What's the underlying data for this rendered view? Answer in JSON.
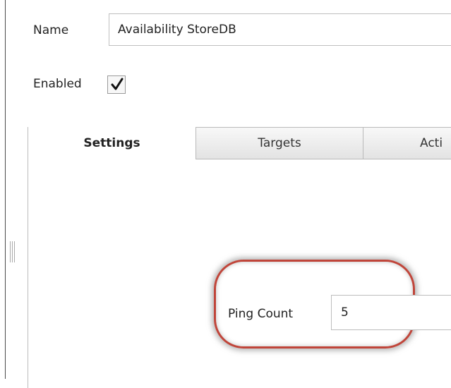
{
  "form": {
    "name_label": "Name",
    "name_value": "Availability StoreDB",
    "enabled_label": "Enabled",
    "enabled_checked": true
  },
  "tabs": [
    {
      "label": "Settings",
      "active": true
    },
    {
      "label": "Targets",
      "active": false
    },
    {
      "label": "Acti",
      "active": false
    }
  ],
  "settings": {
    "ping_count_label": "Ping Count",
    "ping_count_value": "5"
  },
  "colors": {
    "highlight": "#c0453a",
    "border": "#bdbdbd"
  }
}
